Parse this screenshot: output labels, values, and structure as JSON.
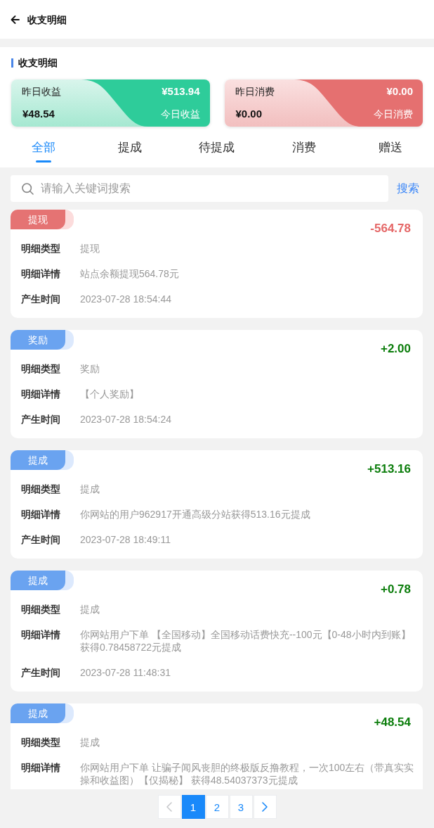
{
  "header": {
    "title": "收支明细"
  },
  "section": {
    "title": "收支明细"
  },
  "summary_cards": [
    {
      "kind": "income",
      "yesterday_label": "昨日收益",
      "today_amount": "¥513.94",
      "yesterday_amount": "¥48.54",
      "today_label": "今日收益"
    },
    {
      "kind": "expense",
      "yesterday_label": "昨日消费",
      "today_amount": "¥0.00",
      "yesterday_amount": "¥0.00",
      "today_label": "今日消费"
    }
  ],
  "tabs": [
    {
      "label": "全部",
      "selected": true
    },
    {
      "label": "提成",
      "selected": false
    },
    {
      "label": "待提成",
      "selected": false
    },
    {
      "label": "消费",
      "selected": false
    },
    {
      "label": "赠送",
      "selected": false
    }
  ],
  "search": {
    "placeholder": "请输入关键词搜索",
    "button": "搜索"
  },
  "records": [
    {
      "kind": "debit",
      "tag": "提现",
      "amount": "-564.78",
      "rows": [
        {
          "label": "明细类型",
          "value": "提现"
        },
        {
          "label": "明细详情",
          "value": "站点余额提现564.78元"
        },
        {
          "label": "产生时间",
          "value": "2023-07-28 18:54:44"
        }
      ]
    },
    {
      "kind": "credit",
      "tag": "奖励",
      "amount": "+2.00",
      "rows": [
        {
          "label": "明细类型",
          "value": "奖励"
        },
        {
          "label": "明细详情",
          "value": "【个人奖励】"
        },
        {
          "label": "产生时间",
          "value": "2023-07-28 18:54:24"
        }
      ]
    },
    {
      "kind": "credit",
      "tag": "提成",
      "amount": "+513.16",
      "rows": [
        {
          "label": "明细类型",
          "value": "提成"
        },
        {
          "label": "明细详情",
          "value": "你网站的用户962917开通高级分站获得513.16元提成"
        },
        {
          "label": "产生时间",
          "value": "2023-07-28 18:49:11"
        }
      ]
    },
    {
      "kind": "credit",
      "tag": "提成",
      "amount": "+0.78",
      "rows": [
        {
          "label": "明细类型",
          "value": "提成"
        },
        {
          "label": "明细详情",
          "value": "你网站用户下单 【全国移动】全国移动话费快充--100元【0-48小时内到账】获得0.78458722元提成"
        },
        {
          "label": "产生时间",
          "value": "2023-07-28 11:48:31"
        }
      ]
    },
    {
      "kind": "credit",
      "tag": "提成",
      "amount": "+48.54",
      "rows": [
        {
          "label": "明细类型",
          "value": "提成"
        },
        {
          "label": "明细详情",
          "value": "你网站用户下单 让骗子闻风丧胆的终极版反撸教程，一次100左右（带真实实操和收益图）【仅揭秘】 获得48.54037373元提成"
        }
      ]
    }
  ],
  "pagination": {
    "prev": {
      "disabled": true
    },
    "pages": [
      {
        "label": "1",
        "selected": true
      },
      {
        "label": "2",
        "selected": false
      },
      {
        "label": "3",
        "selected": false
      }
    ],
    "next": {
      "disabled": false
    }
  }
}
